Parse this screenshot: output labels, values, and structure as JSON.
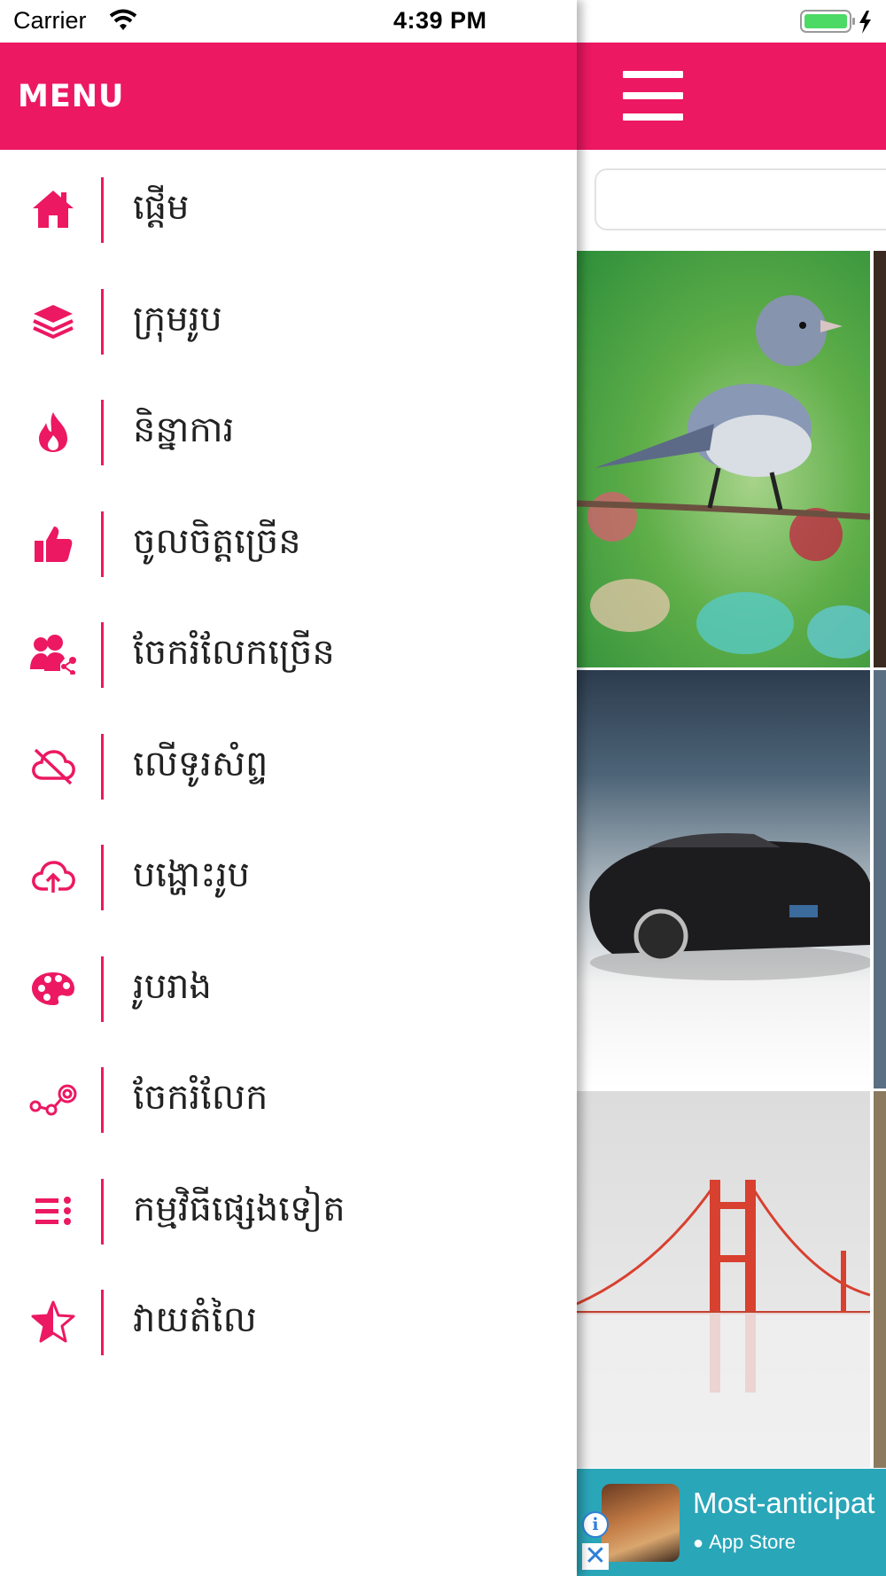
{
  "status_bar": {
    "carrier": "Carrier",
    "time": "4:39 PM"
  },
  "drawer": {
    "title": "MENU",
    "accent_color": "#ec1862",
    "items": [
      {
        "label": "ផ្ដើម",
        "icon": "home-icon"
      },
      {
        "label": "ក្រុមរូប",
        "icon": "layers-icon"
      },
      {
        "label": "និន្នាការ",
        "icon": "fire-icon"
      },
      {
        "label": "ចូលចិត្តច្រើន",
        "icon": "thumbs-up-icon"
      },
      {
        "label": "ចែករំលែកច្រើន",
        "icon": "user-share-icon"
      },
      {
        "label": "លើទូរសំព្ទ",
        "icon": "cloud-off-icon"
      },
      {
        "label": "បង្ហោះរូប",
        "icon": "cloud-upload-icon"
      },
      {
        "label": "រូបរាង",
        "icon": "palette-icon"
      },
      {
        "label": "ចែករំលែក",
        "icon": "share-nodes-icon"
      },
      {
        "label": "កម្មវិធីផ្សេងទៀត",
        "icon": "list-icon"
      },
      {
        "label": "វាយតំលៃ",
        "icon": "star-half-icon"
      }
    ]
  },
  "main": {
    "menu_button": "hamburger-menu-icon",
    "gallery": [
      "bird",
      "car",
      "bridge"
    ]
  },
  "ad": {
    "title": "Most-anticipat",
    "store": "App Store",
    "info_icon": "info-icon",
    "close_icon": "close-icon"
  }
}
